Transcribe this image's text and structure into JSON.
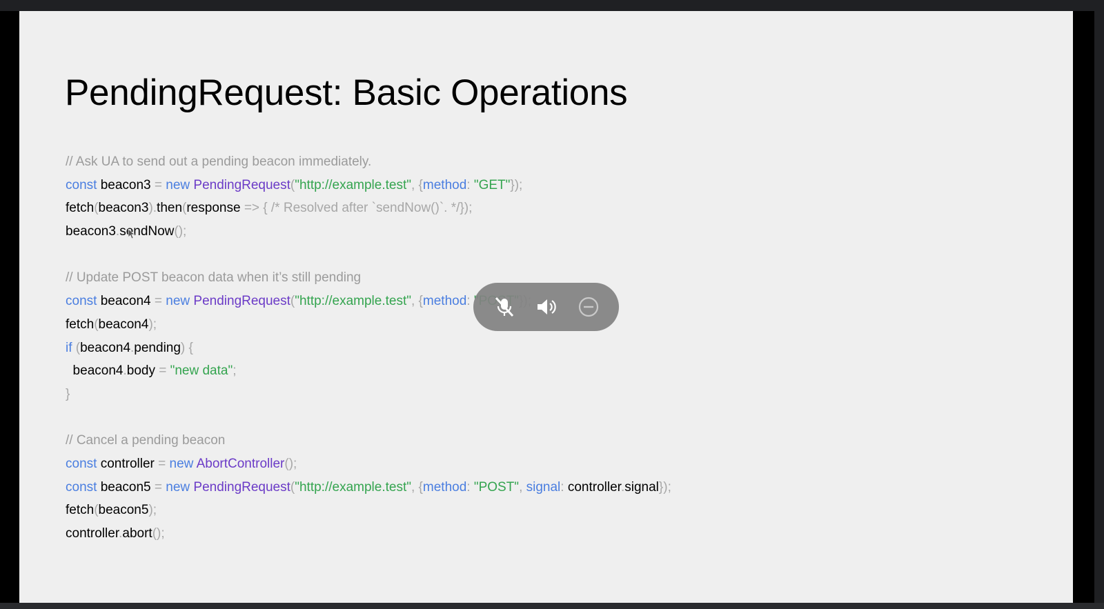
{
  "slide": {
    "title": "PendingRequest: Basic Operations",
    "code_lines": [
      [
        [
          "cm",
          "// Ask UA to send out a pending beacon immediately."
        ]
      ],
      [
        [
          "kw",
          "const "
        ],
        [
          "id",
          "beacon3 "
        ],
        [
          "pu",
          "= "
        ],
        [
          "kw",
          "new "
        ],
        [
          "cl",
          "PendingRequest"
        ],
        [
          "pu",
          "("
        ],
        [
          "st",
          "\"http://example.test\""
        ],
        [
          "pu",
          ", {"
        ],
        [
          "kw",
          "method"
        ],
        [
          "pu",
          ": "
        ],
        [
          "st",
          "\"GET\""
        ],
        [
          "pu",
          "});"
        ]
      ],
      [
        [
          "id",
          "fetch"
        ],
        [
          "pu",
          "("
        ],
        [
          "id",
          "beacon3"
        ],
        [
          "pu",
          ")."
        ],
        [
          "id",
          "then"
        ],
        [
          "pu",
          "("
        ],
        [
          "id",
          "response "
        ],
        [
          "pu",
          "=> { /* Resolved after `sendNow()`. */});"
        ]
      ],
      [
        [
          "id",
          "beacon3"
        ],
        [
          "pu",
          "."
        ],
        [
          "id",
          "sendNow"
        ],
        [
          "pu",
          "();"
        ]
      ],
      [],
      [
        [
          "cm",
          "// Update POST beacon data when it’s still pending"
        ]
      ],
      [
        [
          "kw",
          "const "
        ],
        [
          "id",
          "beacon4 "
        ],
        [
          "pu",
          "= "
        ],
        [
          "kw",
          "new "
        ],
        [
          "cl",
          "PendingRequest"
        ],
        [
          "pu",
          "("
        ],
        [
          "st",
          "\"http://example.test\""
        ],
        [
          "pu",
          ", {"
        ],
        [
          "kw",
          "method"
        ],
        [
          "pu",
          ": "
        ],
        [
          "st",
          "\"POST\""
        ],
        [
          "pu",
          "});"
        ]
      ],
      [
        [
          "id",
          "fetch"
        ],
        [
          "pu",
          "("
        ],
        [
          "id",
          "beacon4"
        ],
        [
          "pu",
          ");"
        ]
      ],
      [
        [
          "kw",
          "if "
        ],
        [
          "pu",
          "("
        ],
        [
          "id",
          "beacon4"
        ],
        [
          "pu",
          "."
        ],
        [
          "id",
          "pending"
        ],
        [
          "pu",
          ") {"
        ]
      ],
      [
        [
          "id",
          "  beacon4"
        ],
        [
          "pu",
          "."
        ],
        [
          "id",
          "body "
        ],
        [
          "pu",
          "= "
        ],
        [
          "st",
          "\"new data\""
        ],
        [
          "pu",
          ";"
        ]
      ],
      [
        [
          "pu",
          "}"
        ]
      ],
      [],
      [
        [
          "cm",
          "// Cancel a pending beacon"
        ]
      ],
      [
        [
          "kw",
          "const "
        ],
        [
          "id",
          "controller "
        ],
        [
          "pu",
          "= "
        ],
        [
          "kw",
          "new "
        ],
        [
          "cl",
          "AbortController"
        ],
        [
          "pu",
          "();"
        ]
      ],
      [
        [
          "kw",
          "const "
        ],
        [
          "id",
          "beacon5 "
        ],
        [
          "pu",
          "= "
        ],
        [
          "kw",
          "new "
        ],
        [
          "cl",
          "PendingRequest"
        ],
        [
          "pu",
          "("
        ],
        [
          "st",
          "\"http://example.test\""
        ],
        [
          "pu",
          ", {"
        ],
        [
          "kw",
          "method"
        ],
        [
          "pu",
          ": "
        ],
        [
          "st",
          "\"POST\""
        ],
        [
          "pu",
          ", "
        ],
        [
          "kw",
          "signal"
        ],
        [
          "pu",
          ": "
        ],
        [
          "id",
          "controller"
        ],
        [
          "pu",
          "."
        ],
        [
          "id",
          "signal"
        ],
        [
          "pu",
          "});"
        ]
      ],
      [
        [
          "id",
          "fetch"
        ],
        [
          "pu",
          "("
        ],
        [
          "id",
          "beacon5"
        ],
        [
          "pu",
          ");"
        ]
      ],
      [
        [
          "id",
          "controller"
        ],
        [
          "pu",
          "."
        ],
        [
          "id",
          "abort"
        ],
        [
          "pu",
          "();"
        ]
      ]
    ]
  },
  "media_controls": {
    "icons": [
      "mic-off-icon",
      "volume-icon",
      "minus-circle-icon"
    ],
    "background": "#828282"
  },
  "colors": {
    "keyword": "#4a7ee0",
    "class": "#6b3bc7",
    "string": "#34a44f",
    "comment": "#9b9b9b",
    "punctuation": "#a7a7a7"
  }
}
